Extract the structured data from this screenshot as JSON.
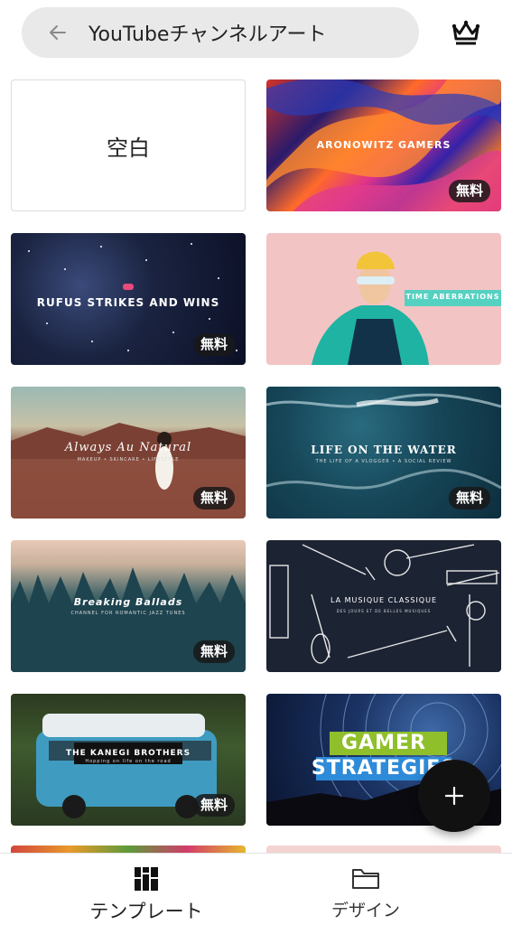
{
  "header": {
    "search_text": "YouTubeチャンネルアート",
    "back_icon": "arrow-left-icon",
    "premium_icon": "crown-icon"
  },
  "templates": {
    "blank_label": "空白",
    "free_badge": "無料",
    "cards": [
      {
        "title": "ARONOWITZ GAMERS",
        "badge": true
      },
      {
        "title": "RUFUS STRIKES AND WINS",
        "badge": true
      },
      {
        "title": "TIME ABERRATIONS",
        "badge": false
      },
      {
        "title": "Always Au Natural",
        "subtitle": "MAKEUP • SKINCARE • LIFESTYLE",
        "badge": true
      },
      {
        "title": "LIFE ON THE WATER",
        "subtitle": "THE LIFE OF A VLOGGER • A SOCIAL REVIEW",
        "badge": true
      },
      {
        "title": "Breaking Ballads",
        "subtitle": "CHANNEL FOR ROMANTIC JAZZ TUNES",
        "badge": true
      },
      {
        "title": "LA MUSIQUE CLASSIQUE",
        "subtitle": "DES JOURS ET DE BELLES MUSIQUES",
        "badge": false
      },
      {
        "title": "THE KANEGI BROTHERS",
        "subtitle": "Hopping on life on the road",
        "badge": true
      },
      {
        "title_line1": "GAMER",
        "title_line2": "STRATEGIES",
        "badge": false
      }
    ]
  },
  "fab": {
    "icon": "plus-icon"
  },
  "bottom_nav": {
    "templates_label": "テンプレート",
    "templates_icon": "grid-icon",
    "design_label": "デザイン",
    "design_icon": "folder-icon"
  },
  "colors": {
    "accent_teal": "#55d1c1",
    "gamer_green": "#8fbf2a",
    "badge_bg": "#191919"
  }
}
